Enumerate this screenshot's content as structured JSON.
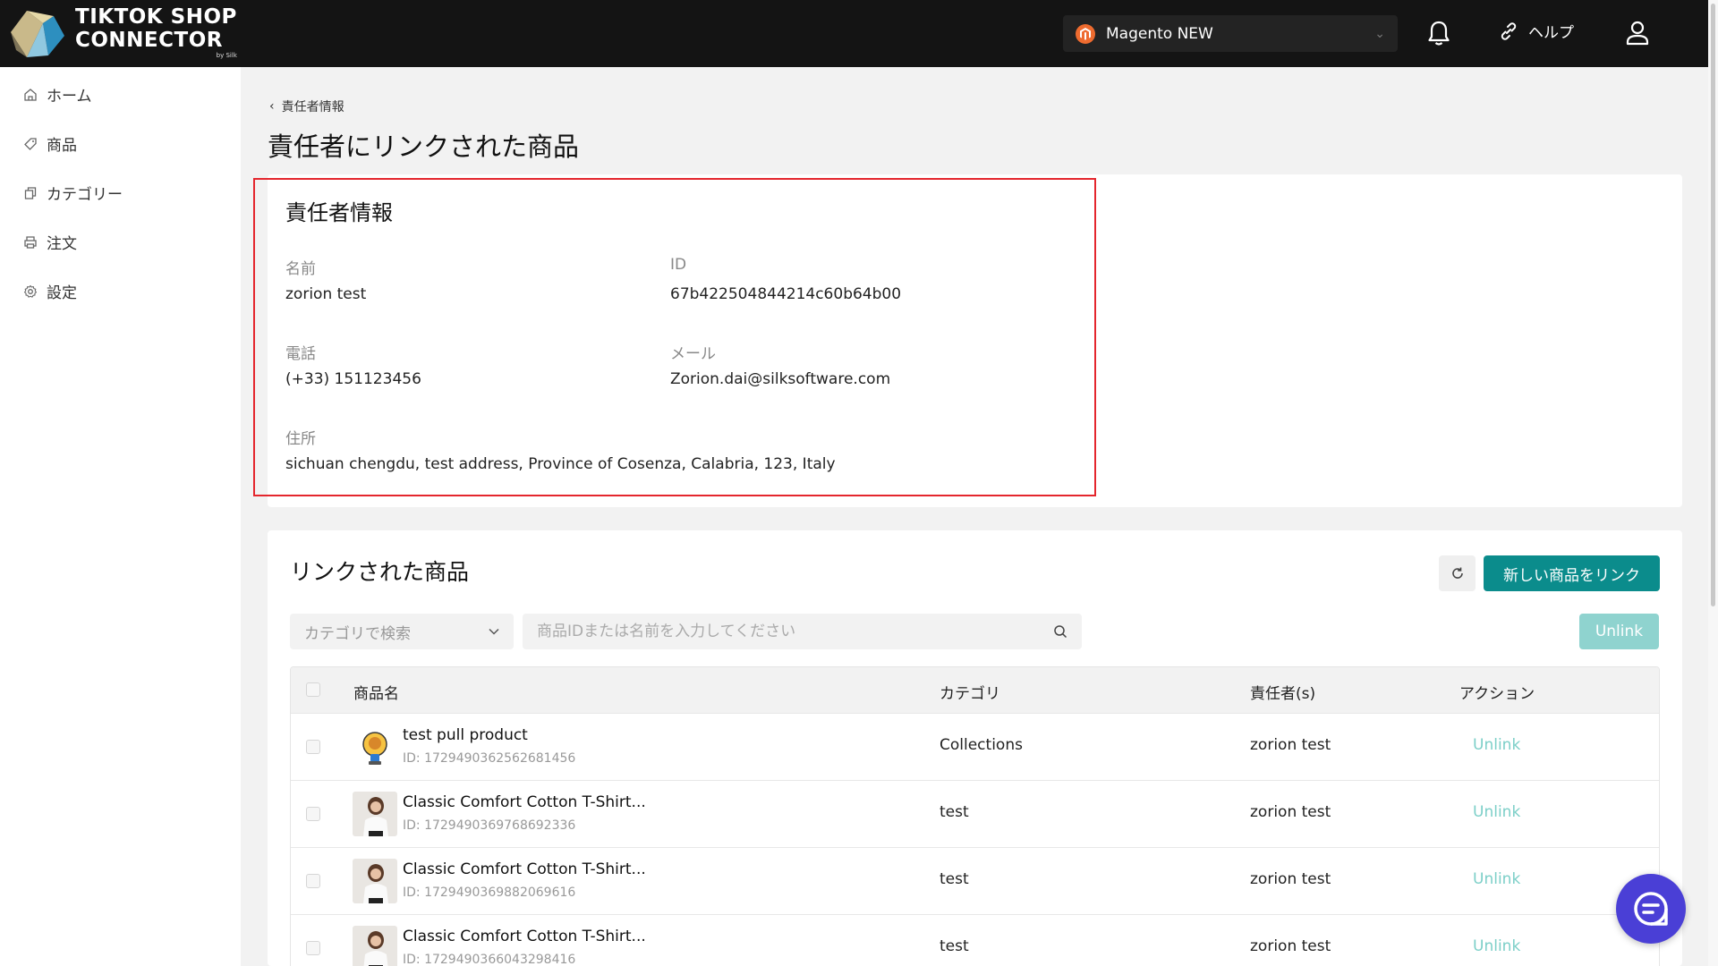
{
  "brand": {
    "line1": "TIKTOK SHOP",
    "line2": "CONNECTOR",
    "by": "by Silk"
  },
  "header": {
    "store": "Magento NEW",
    "help": "ヘルプ"
  },
  "sidebar": {
    "items": [
      {
        "label": "ホーム",
        "icon": "home-icon"
      },
      {
        "label": "商品",
        "icon": "tag-icon"
      },
      {
        "label": "カテゴリー",
        "icon": "copy-icon"
      },
      {
        "label": "注文",
        "icon": "printer-icon"
      },
      {
        "label": "設定",
        "icon": "gear-icon"
      }
    ]
  },
  "breadcrumb": "責任者情報",
  "page_title": "責任者にリンクされた商品",
  "info": {
    "title": "責任者情報",
    "name_label": "名前",
    "name": "zorion test",
    "id_label": "ID",
    "id": "67b422504844214c60b64b00",
    "phone_label": "電話",
    "phone": "(+33) 151123456",
    "email_label": "メール",
    "email": "Zorion.dai@silksoftware.com",
    "address_label": "住所",
    "address": "sichuan chengdu, test address, Province of Cosenza, Calabria, 123, Italy"
  },
  "linked": {
    "title": "リンクされた商品",
    "link_button": "新しい商品をリンク",
    "category_placeholder": "カテゴリで検索",
    "search_placeholder": "商品IDまたは名前を入力してください",
    "unlink_button": "Unlink",
    "columns": {
      "name": "商品名",
      "category": "カテゴリ",
      "owner": "責任者(s)",
      "action": "アクション"
    },
    "rows": [
      {
        "name": "test pull product",
        "id": "ID: 1729490362562681456",
        "category": "Collections",
        "owner": "zorion test",
        "action": "Unlink"
      },
      {
        "name": "Classic Comfort Cotton T-Shirt...",
        "id": "ID: 1729490369768692336",
        "category": "test",
        "owner": "zorion test",
        "action": "Unlink"
      },
      {
        "name": "Classic Comfort Cotton T-Shirt...",
        "id": "ID: 1729490369882069616",
        "category": "test",
        "owner": "zorion test",
        "action": "Unlink"
      },
      {
        "name": "Classic Comfort Cotton T-Shirt...",
        "id": "ID: 1729490366043298416",
        "category": "test",
        "owner": "zorion test",
        "action": "Unlink"
      }
    ]
  },
  "colors": {
    "accent": "#0b8c8c",
    "highlight": "#e4262d",
    "topbar": "#141414",
    "chat": "#4a3fd6"
  }
}
